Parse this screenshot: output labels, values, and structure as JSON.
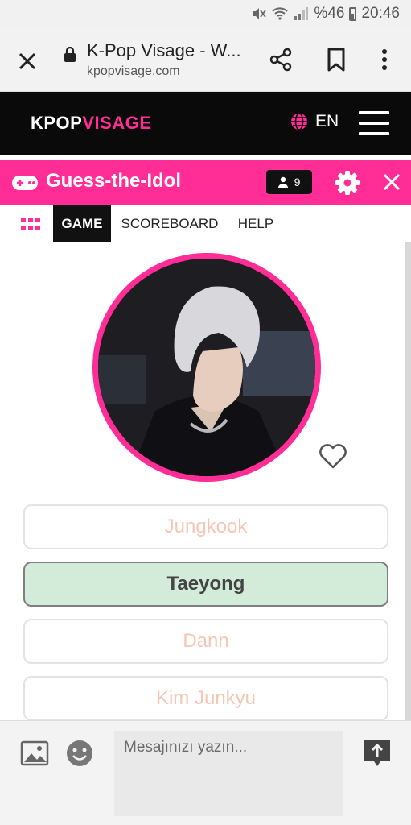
{
  "status_bar": {
    "battery_text": "%46",
    "time": "20:46"
  },
  "tab": {
    "title": "K-Pop Visage - W...",
    "url": "kpopvisage.com"
  },
  "site_header": {
    "logo_part1": "KPOP",
    "logo_part2": "VISAGE",
    "language": "EN"
  },
  "game_header": {
    "title": "Guess-the-Idol",
    "player_count": "9"
  },
  "nav": {
    "tabs": [
      {
        "label": "GAME",
        "active": true
      },
      {
        "label": "SCOREBOARD",
        "active": false
      },
      {
        "label": "HELP",
        "active": false
      }
    ]
  },
  "answers": [
    {
      "label": "Jungkook",
      "state": "normal"
    },
    {
      "label": "Taeyong",
      "state": "correct"
    },
    {
      "label": "Dann",
      "state": "normal"
    },
    {
      "label": "Kim Junkyu",
      "state": "normal"
    }
  ],
  "chat": {
    "placeholder": "Mesajınızı yazın..."
  },
  "icons": [
    "mute-icon",
    "wifi-icon",
    "signal-icon",
    "battery-icon",
    "close-icon",
    "lock-icon",
    "share-icon",
    "bookmark-icon",
    "more-vert-icon",
    "globe-icon",
    "menu-icon",
    "gamepad-icon",
    "person-icon",
    "gear-icon",
    "apps-grid-icon",
    "heart-icon",
    "image-icon",
    "emoji-icon",
    "send-icon"
  ],
  "colors": {
    "accent": "#ff2d95",
    "header_bg": "#0a0a0a",
    "correct_bg": "#d3ecda",
    "answer_text": "#f4c6b3"
  }
}
